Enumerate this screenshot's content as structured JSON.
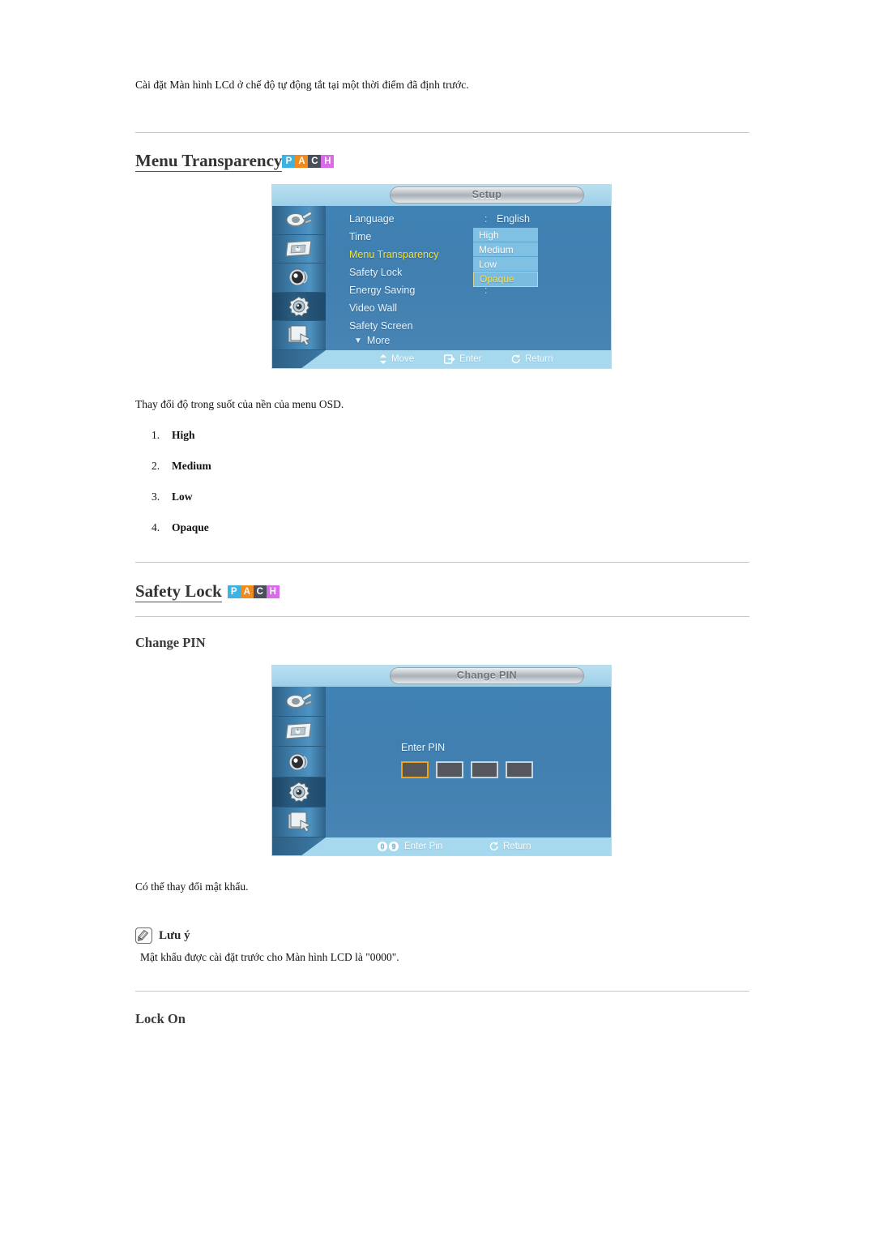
{
  "document": {
    "intro_line": "Cài đặt Màn hình LCd ở chế độ tự động tắt tại một thời điểm đã định trước."
  },
  "badges": {
    "p": "P",
    "a": "A",
    "c": "C",
    "h": "H",
    "colors": {
      "p": "#3eb2e0",
      "a": "#f08a1e",
      "c": "#4b4f5c",
      "h": "#d96be8"
    }
  },
  "section_menu_transparency": {
    "heading": "Menu Transparency",
    "description": "Thay đổi độ trong suốt của nền của menu OSD.",
    "options": [
      {
        "num": "1.",
        "label": "High"
      },
      {
        "num": "2.",
        "label": "Medium"
      },
      {
        "num": "3.",
        "label": "Low"
      },
      {
        "num": "4.",
        "label": "Opaque"
      }
    ],
    "osd": {
      "title": "Setup",
      "rows": [
        {
          "label": "Language",
          "colon": ":",
          "value": "English",
          "selected": false
        },
        {
          "label": "Time",
          "colon": "",
          "value": "",
          "selected": false
        },
        {
          "label": "Menu Transparency",
          "colon": ":",
          "value": "",
          "selected": true
        },
        {
          "label": "Safety Lock",
          "colon": "",
          "value": "",
          "selected": false
        },
        {
          "label": "Energy Saving",
          "colon": ":",
          "value": "",
          "selected": false
        },
        {
          "label": "Video Wall",
          "colon": "",
          "value": "",
          "selected": false
        },
        {
          "label": "Safety Screen",
          "colon": "",
          "value": "",
          "selected": false
        }
      ],
      "more_label": "More",
      "dropdown": [
        {
          "label": "High",
          "selected": false
        },
        {
          "label": "Medium",
          "selected": false
        },
        {
          "label": "Low",
          "selected": false
        },
        {
          "label": "Opaque",
          "selected": true
        }
      ],
      "bottom": {
        "move": "Move",
        "enter": "Enter",
        "return": "Return"
      }
    }
  },
  "section_safety_lock": {
    "heading": "Safety Lock",
    "sub_heading_change_pin": "Change PIN",
    "description": "Có thể thay đổi mật khẩu.",
    "note": {
      "title": "Lưu ý",
      "body": "Mật khẩu được cài đặt trước cho Màn hình LCD là \"0000\"."
    },
    "sub_heading_lock_on": "Lock On",
    "osd": {
      "title": "Change PIN",
      "pin_label": "Enter PIN",
      "pin_boxes": [
        "",
        "",
        "",
        ""
      ],
      "bottom": {
        "key_low": "0",
        "key_high": "9",
        "enter_pin": "Enter Pin",
        "return": "Return"
      }
    }
  }
}
